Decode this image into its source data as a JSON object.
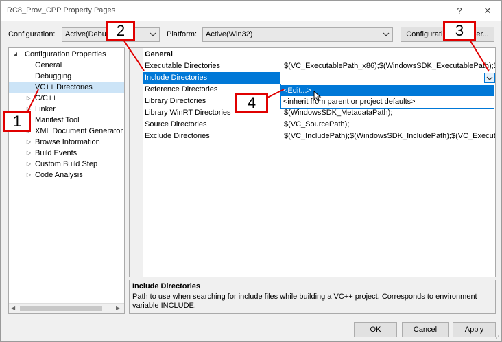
{
  "window": {
    "title": "RC8_Prov_CPP Property Pages",
    "help_label": "?",
    "close_label": "✕"
  },
  "config": {
    "configuration_label": "Configuration:",
    "configuration_value": "Active(Debug)",
    "platform_label": "Platform:",
    "platform_value": "Active(Win32)",
    "manager_button": "Configuration Manager..."
  },
  "tree": {
    "root": "Configuration Properties",
    "items": [
      "General",
      "Debugging",
      "VC++ Directories",
      "C/C++",
      "Linker",
      "Manifest Tool",
      "XML Document Generator",
      "Browse Information",
      "Build Events",
      "Custom Build Step",
      "Code Analysis"
    ]
  },
  "grid": {
    "section": "General",
    "rows": [
      {
        "name": "Executable Directories",
        "value": "$(VC_ExecutablePath_x86);$(WindowsSDK_ExecutablePath);$(VS_E"
      },
      {
        "name": "Include Directories",
        "value": ""
      },
      {
        "name": "Reference Directories",
        "value": ""
      },
      {
        "name": "Library Directories",
        "value": ""
      },
      {
        "name": "Library WinRT Directories",
        "value": "$(WindowsSDK_MetadataPath);"
      },
      {
        "name": "Source Directories",
        "value": "$(VC_SourcePath);"
      },
      {
        "name": "Exclude Directories",
        "value": "$(VC_IncludePath);$(WindowsSDK_IncludePath);$(VC_ExecutableP"
      }
    ],
    "dropdown_options": [
      "<Edit...>",
      "<inherit from parent or project defaults>"
    ]
  },
  "description": {
    "title": "Include Directories",
    "text": "Path to use when searching for include files while building a VC++ project.  Corresponds to environment variable INCLUDE."
  },
  "buttons": {
    "ok": "OK",
    "cancel": "Cancel",
    "apply": "Apply"
  },
  "callouts": [
    "1",
    "2",
    "3",
    "4"
  ],
  "colors": {
    "selection": "#0078d7",
    "tree_selection": "#cce4f7",
    "callout": "#e00000"
  }
}
